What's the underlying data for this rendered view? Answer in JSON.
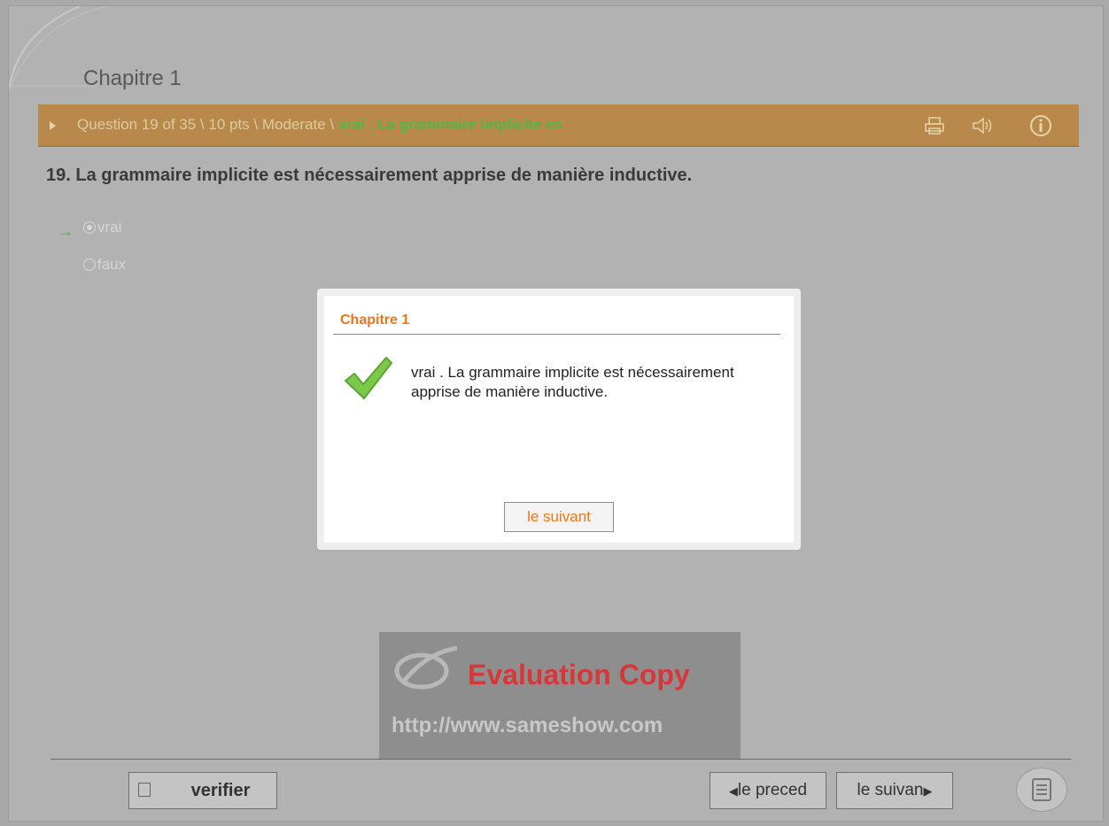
{
  "chapter": {
    "title": "Chapitre 1"
  },
  "question_bar": {
    "info": "Question 19 of 35 \\ 10 pts \\ Moderate \\ ",
    "answer_preview": "vrai . La grammaire implicite es"
  },
  "question": {
    "text": "19.  La grammaire implicite est nécessairement apprise de manière inductive."
  },
  "answers": [
    {
      "label": "vrai",
      "selected": true
    },
    {
      "label": "faux",
      "selected": false
    }
  ],
  "dialog": {
    "title": "Chapitre 1",
    "message": "vrai . La grammaire implicite est nécessairement apprise de manière inductive.",
    "button": "le suivant"
  },
  "watermark": {
    "title": "Evaluation Copy",
    "url": "http://www.sameshow.com"
  },
  "footer": {
    "verify": "verifier",
    "prev": "le preced",
    "next": "le suivan"
  },
  "colors": {
    "bar": "#b8894a",
    "accent": "#e8761c",
    "correct": "#4fb84a"
  },
  "icons": [
    "print-icon",
    "speaker-icon",
    "info-icon",
    "check-icon",
    "notes-icon"
  ]
}
